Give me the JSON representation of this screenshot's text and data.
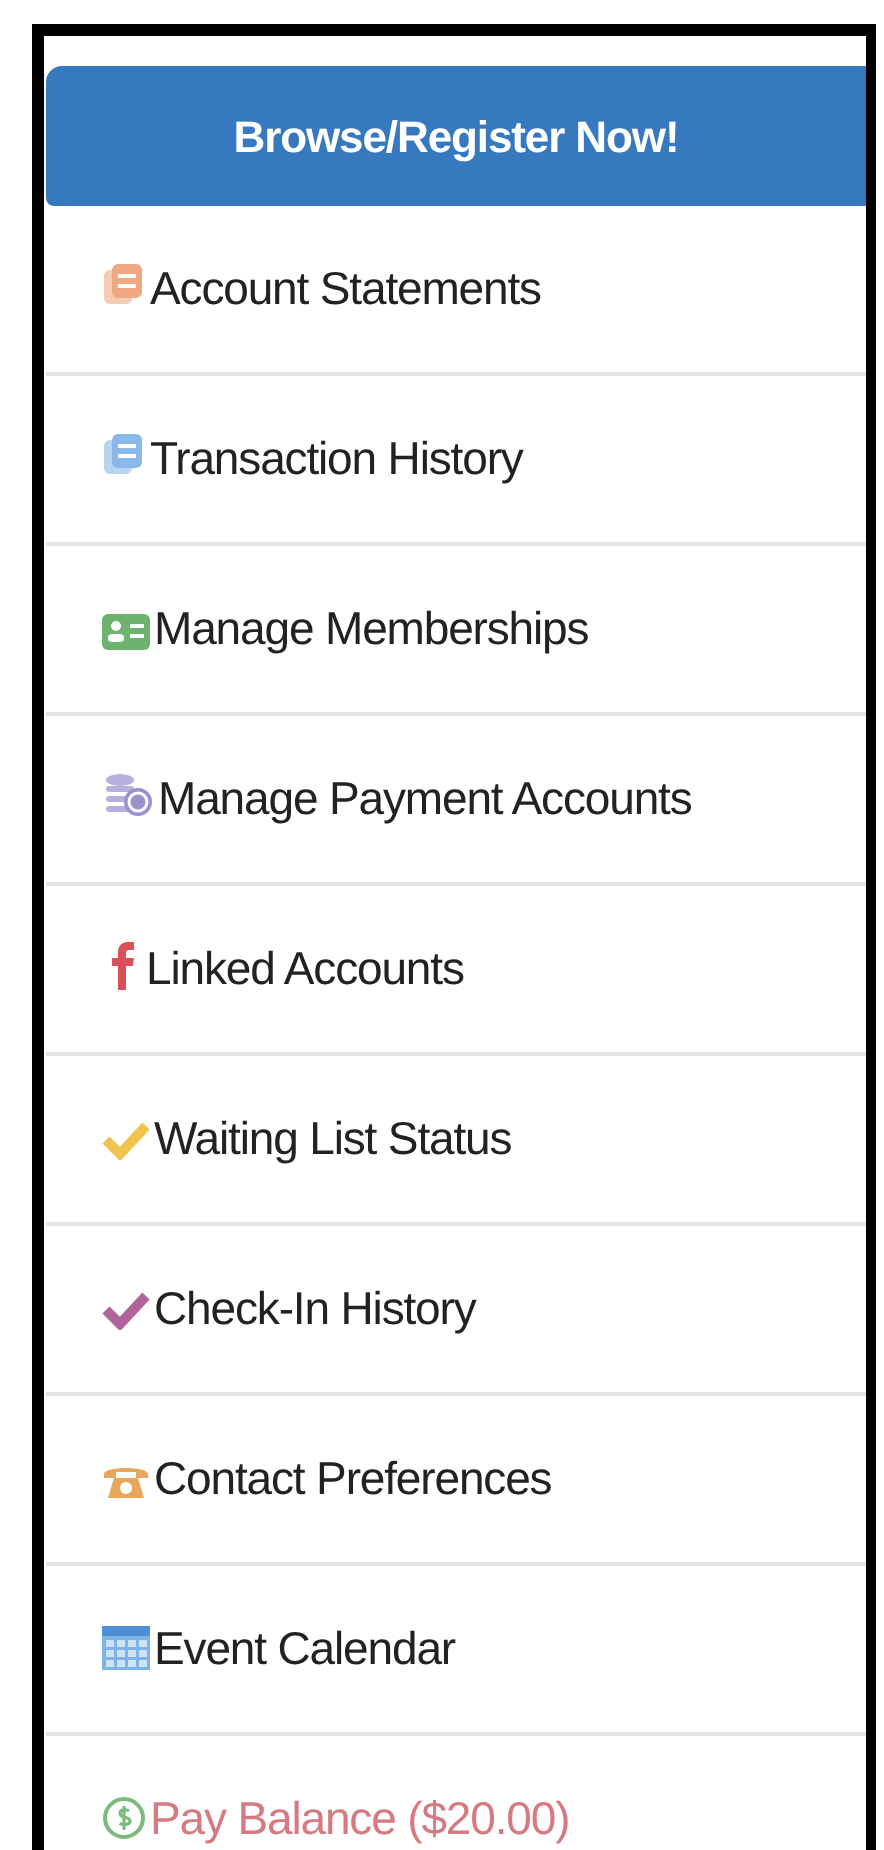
{
  "register_button": {
    "label": "Browse/Register Now!"
  },
  "menu_items": [
    {
      "kind": "statements",
      "label": "Account Statements"
    },
    {
      "kind": "transactions",
      "label": "Transaction History"
    },
    {
      "kind": "memberships",
      "label": "Manage Memberships"
    },
    {
      "kind": "payment",
      "label": "Manage Payment Accounts"
    },
    {
      "kind": "linked",
      "label": "Linked Accounts"
    },
    {
      "kind": "waitlist",
      "label": "Waiting List Status"
    },
    {
      "kind": "checkin",
      "label": "Check-In History"
    },
    {
      "kind": "contact",
      "label": "Contact Preferences"
    },
    {
      "kind": "calendar",
      "label": "Event Calendar"
    },
    {
      "kind": "balance",
      "label": "Pay Balance ($20.00)"
    }
  ]
}
